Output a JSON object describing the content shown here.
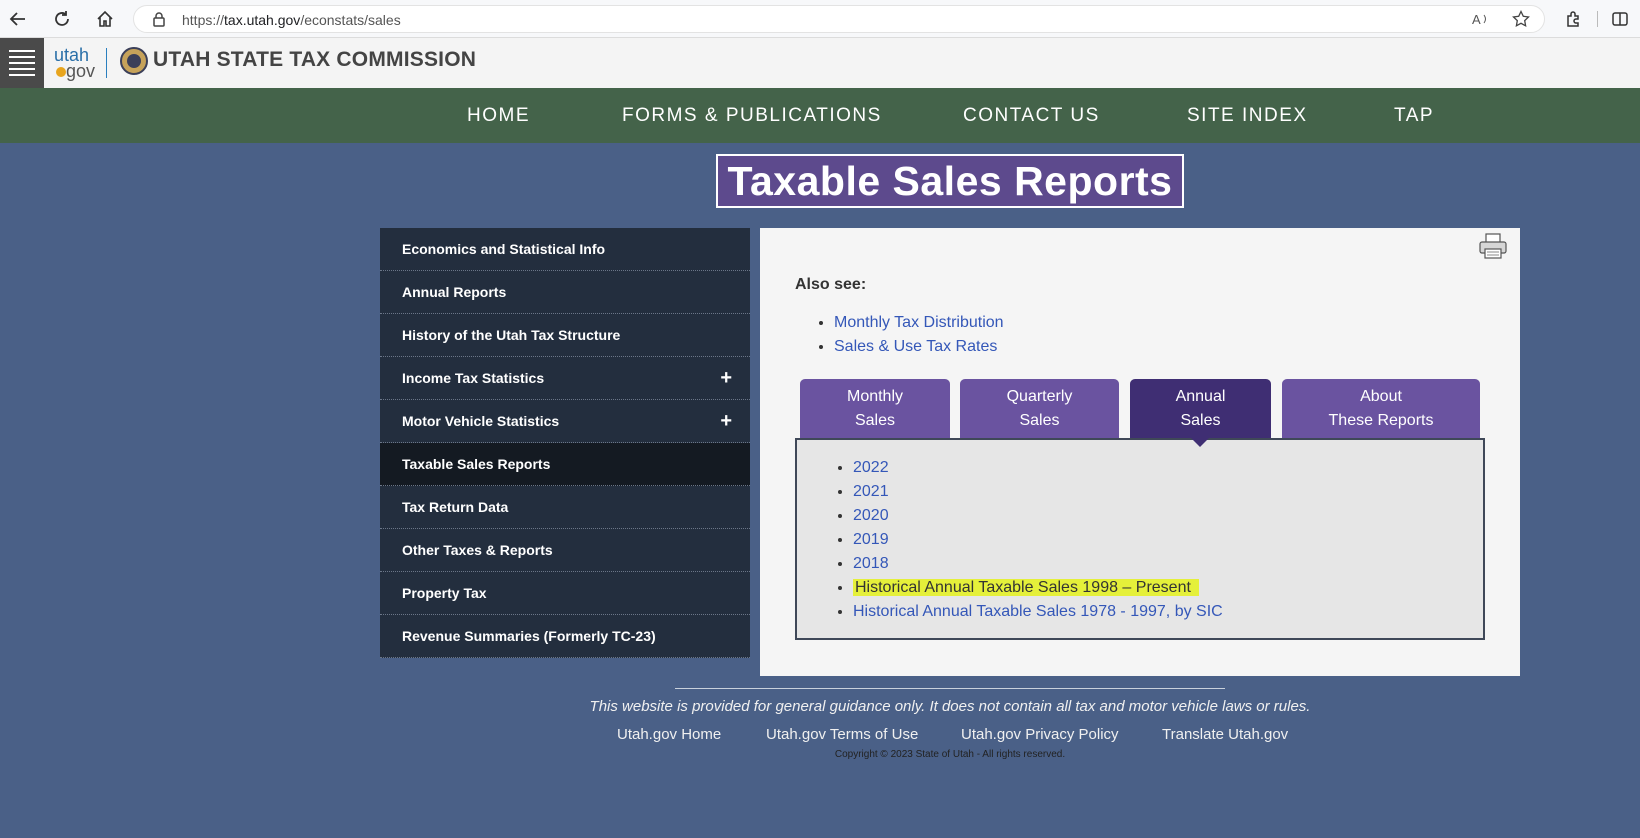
{
  "browser": {
    "url_prefix": "https://",
    "url_host": "tax.utah.gov",
    "url_path": "/econstats/sales"
  },
  "header": {
    "logo_top": "utah",
    "logo_bottom": "gov",
    "site_title": "UTAH STATE TAX COMMISSION"
  },
  "nav": {
    "home": "HOME",
    "forms": "FORMS & PUBLICATIONS",
    "contact": "CONTACT US",
    "site_index": "SITE INDEX",
    "tap": "TAP"
  },
  "page_title": "Taxable Sales Reports",
  "sidebar": {
    "items": [
      {
        "label": "Economics and Statistical Info"
      },
      {
        "label": "Annual Reports"
      },
      {
        "label": "History of the Utah Tax Structure"
      },
      {
        "label": "Income Tax Statistics",
        "expand": "+"
      },
      {
        "label": "Motor Vehicle Statistics",
        "expand": "+"
      },
      {
        "label": "Taxable Sales Reports"
      },
      {
        "label": "Tax Return Data"
      },
      {
        "label": "Other Taxes & Reports"
      },
      {
        "label": "Property Tax"
      },
      {
        "label": "Revenue Summaries (Formerly TC-23)"
      }
    ]
  },
  "content": {
    "also_see": "Also see:",
    "also_links": [
      "Monthly Tax Distribution",
      "Sales & Use Tax Rates"
    ],
    "tabs": [
      {
        "line1": "Monthly",
        "line2": "Sales"
      },
      {
        "line1": "Quarterly",
        "line2": "Sales"
      },
      {
        "line1": "Annual",
        "line2": "Sales"
      },
      {
        "line1": "About",
        "line2": "These Reports"
      }
    ],
    "annual_links": [
      "2022",
      "2021",
      "2020",
      "2019",
      "2018",
      "Historical Annual Taxable Sales 1998 – Present",
      "Historical Annual Taxable Sales 1978 - 1997, by SIC"
    ]
  },
  "footer": {
    "disclaimer": "This website is provided for general guidance only. It does not contain all tax and motor vehicle laws or rules.",
    "links": [
      "Utah.gov Home",
      "Utah.gov Terms of Use",
      "Utah.gov Privacy Policy",
      "Translate Utah.gov"
    ],
    "copyright": "Copyright © 2023 State of Utah - All rights reserved."
  },
  "colors": {
    "nav_green": "#44634a",
    "page_bg": "#4a6087",
    "title_purple": "#5d4a8d",
    "active_tab": "#3f2e73",
    "highlight": "#e5f03a"
  }
}
